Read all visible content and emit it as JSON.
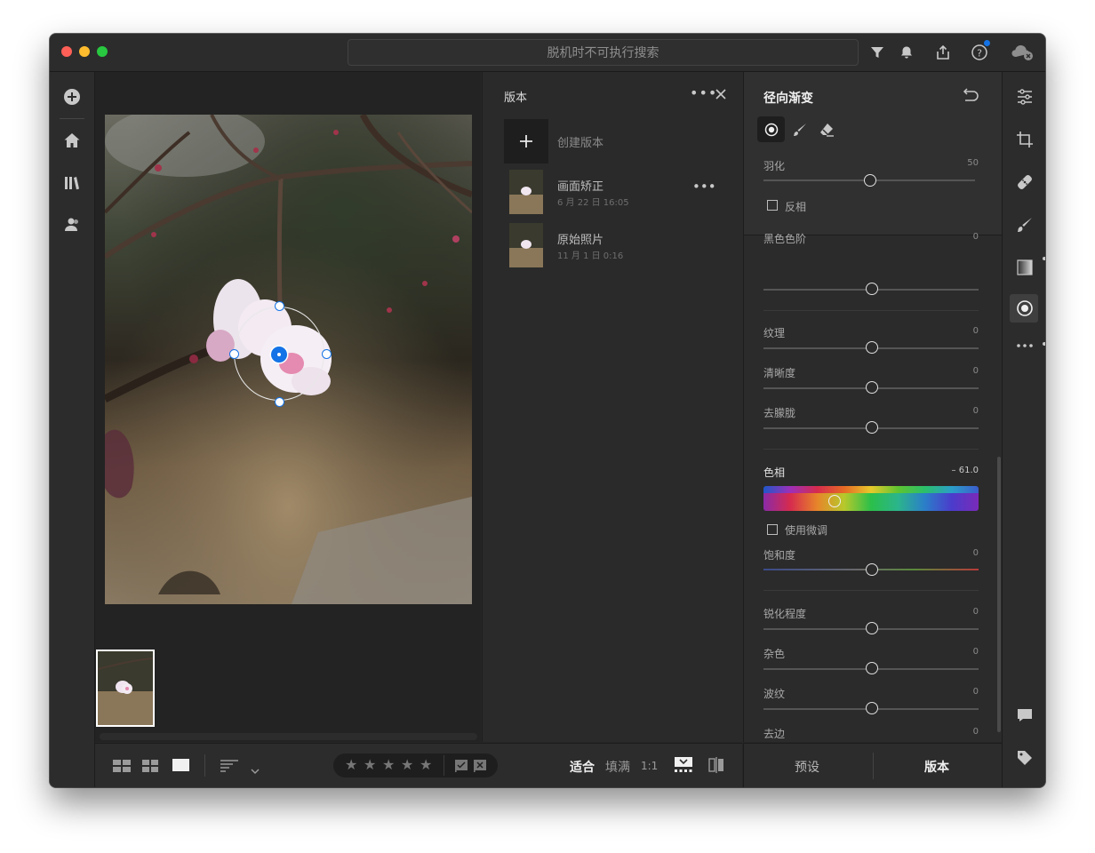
{
  "titlebar": {
    "search_placeholder": "脱机时不可执行搜索",
    "icons": [
      "filter-icon",
      "bell-icon",
      "share-icon",
      "help-icon",
      "cloud-offline-icon"
    ]
  },
  "leftbar": {
    "icons": [
      "add-icon",
      "home-icon",
      "library-icon",
      "people-icon"
    ]
  },
  "versions": {
    "title": "版本",
    "create_label": "创建版本",
    "items": [
      {
        "name": "画面矫正",
        "date": "6 月 22 日 16:05"
      },
      {
        "name": "原始照片",
        "date": "11 月 1 日 0:16"
      }
    ]
  },
  "bottombar": {
    "fit": "适合",
    "fill": "填满",
    "ratio": "1:1",
    "stars": [
      "★",
      "★",
      "★",
      "★",
      "★"
    ]
  },
  "panel": {
    "title": "径向渐变",
    "feather_label": "羽化",
    "feather_value": "50",
    "invert_label": "反相",
    "sliders": [
      {
        "label": "黑色色阶",
        "value": "0"
      },
      {
        "label": "纹理",
        "value": "0"
      },
      {
        "label": "清晰度",
        "value": "0"
      },
      {
        "label": "去朦胧",
        "value": "0"
      }
    ],
    "hue_label": "色相",
    "hue_value": "– 61.0",
    "fine_label": "使用微调",
    "saturation_label": "饱和度",
    "saturation_value": "0",
    "detail_sliders": [
      {
        "label": "锐化程度",
        "value": "0"
      },
      {
        "label": "杂色",
        "value": "0"
      },
      {
        "label": "波纹",
        "value": "0"
      },
      {
        "label": "去边",
        "value": "0"
      }
    ]
  },
  "tabs": {
    "presets": "预设",
    "versions": "版本"
  },
  "colors": {
    "accent": "#1473e6",
    "bg": "#262626",
    "panel": "#2b2b2b"
  }
}
